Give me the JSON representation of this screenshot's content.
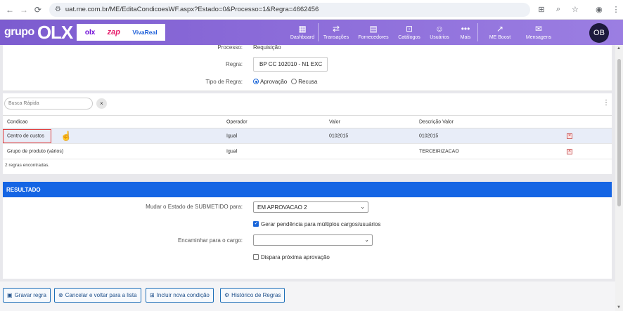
{
  "browser": {
    "url": "uat.me.com.br/ME/EditaCondicoesWF.aspx?Estado=0&Processo=1&Regra=4662456"
  },
  "header": {
    "logo_grupo": "grupo",
    "logo_olx": "OLX",
    "brand_olx": "olx",
    "brand_zap": "zap",
    "brand_vivareal": "VivaReal",
    "nav": [
      {
        "label": "Dashboard",
        "icon": "dashboard-icon"
      },
      {
        "label": "Transações",
        "icon": "transactions-icon"
      },
      {
        "label": "Fornecedores",
        "icon": "suppliers-icon"
      },
      {
        "label": "Catálogos",
        "icon": "catalog-icon"
      },
      {
        "label": "Usuários",
        "icon": "users-icon"
      },
      {
        "label": "Mais",
        "icon": "more-icon"
      },
      {
        "label": "ME Boost",
        "icon": "boost-icon"
      },
      {
        "label": "Mensagens",
        "icon": "messages-icon"
      }
    ],
    "avatar_initials": "OB"
  },
  "form": {
    "processo_label": "Processo:",
    "processo_value": "Requisição",
    "regra_label": "Regra:",
    "regra_value": "BP CC 102010 - N1 EXC",
    "tipo_label": "Tipo de Regra:",
    "tipo_options": [
      "Aprovação",
      "Recusa"
    ],
    "tipo_selected": "Aprovação"
  },
  "conditions": {
    "search_placeholder": "Busca Rápida",
    "clear_label": "×",
    "columns": [
      "Condicao",
      "Operador",
      "Valor",
      "Descrição Valor"
    ],
    "rows": [
      {
        "condicao": "Centro de custos",
        "operador": "Igual",
        "valor": "0102015",
        "descricao": "0102015"
      },
      {
        "condicao": "Grupo de produto (vários)",
        "operador": "Igual",
        "valor": "",
        "descricao": "TERCEIRIZACAO"
      }
    ],
    "count_text": "2 regras encontradas."
  },
  "result": {
    "title": "RESULTADO",
    "estado_label": "Mudar o Estado de SUBMETIDO para:",
    "estado_value": "EM APROVACAO 2",
    "gerar_label": "Gerar pendência para múltiplos cargos/usuários",
    "gerar_checked": true,
    "encaminhar_label": "Encaminhar para o cargo:",
    "encaminhar_value": "",
    "dispara_label": "Dispara próxima aprovação",
    "dispara_checked": false
  },
  "footer": {
    "buttons": [
      {
        "label": "Gravar regra",
        "icon": "save-icon"
      },
      {
        "label": "Cancelar e voltar para a lista",
        "icon": "cancel-icon"
      },
      {
        "label": "Incluir nova condição",
        "icon": "add-condition-icon"
      },
      {
        "label": "Histórico de Regras",
        "icon": "history-icon"
      }
    ]
  }
}
